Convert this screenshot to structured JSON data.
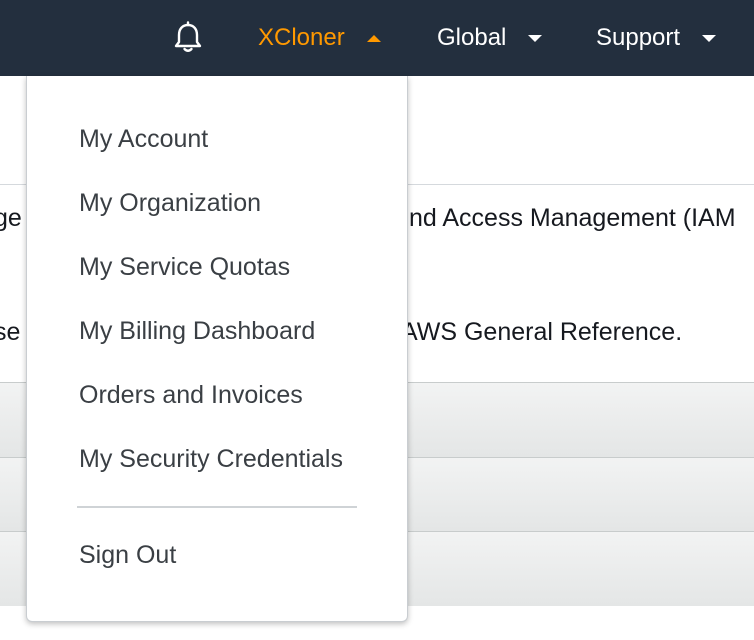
{
  "nav": {
    "notifications_icon": "bell-icon",
    "account_label": "XCloner",
    "region_label": "Global",
    "support_label": "Support",
    "colors": {
      "bar_background": "#232f3e",
      "accent": "#ff9900",
      "text": "#ffffff"
    }
  },
  "account_menu": {
    "items": [
      {
        "label": "My Account"
      },
      {
        "label": "My Organization"
      },
      {
        "label": "My Service Quotas"
      },
      {
        "label": "My Billing Dashboard"
      },
      {
        "label": "Orders and Invoices"
      },
      {
        "label": "My Security Credentials"
      }
    ],
    "sign_out_label": "Sign Out"
  },
  "background": {
    "line1_left": "ge",
    "line1_right": "nd Access Management (IAM",
    "line2_left": "se",
    "line2_right": "AWS General Reference."
  }
}
